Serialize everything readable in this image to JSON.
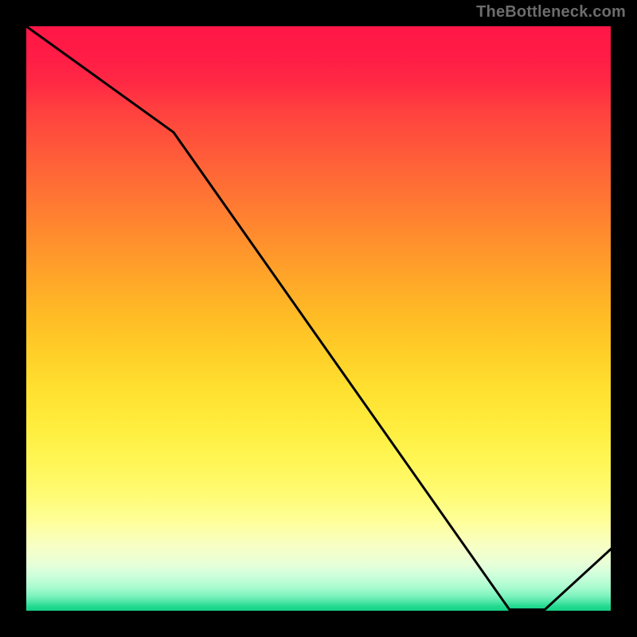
{
  "watermark": "TheBottleneck.com",
  "annotation_label": "",
  "chart_data": {
    "type": "line",
    "title": "",
    "xlabel": "",
    "ylabel": "",
    "xlim": [
      0,
      1
    ],
    "ylim": [
      0,
      1
    ],
    "x": [
      0.0,
      0.25,
      0.82,
      0.88,
      1.0
    ],
    "values": [
      1.0,
      0.82,
      0.01,
      0.01,
      0.12
    ],
    "gradient_stops": [
      {
        "pos": 0.0,
        "color": "#ff1747"
      },
      {
        "pos": 0.5,
        "color": "#ffbd25"
      },
      {
        "pos": 0.85,
        "color": "#feff9c"
      },
      {
        "pos": 1.0,
        "color": "#13d185"
      }
    ],
    "annotations": [
      {
        "text": "",
        "x": 0.85,
        "y": 0.02
      }
    ]
  }
}
